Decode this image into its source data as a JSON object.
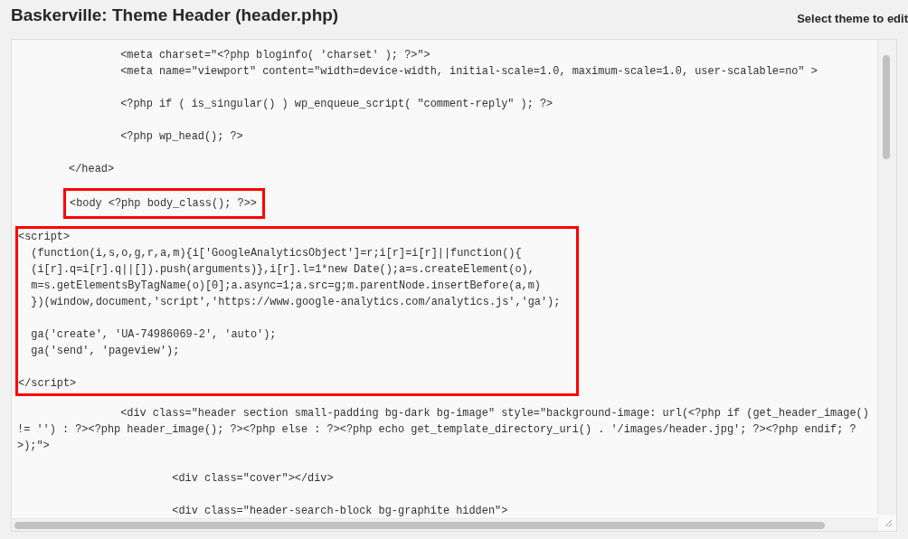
{
  "page_title": "Baskerville: Theme Header (header.php)",
  "theme_select_label": "Select theme to edit",
  "editor": {
    "blocks": [
      {
        "highlighted": false,
        "groups": [
          [
            "                <meta charset=\"<?php bloginfo( 'charset' ); ?>\">",
            "                <meta name=\"viewport\" content=\"width=device-width, initial-scale=1.0, maximum-scale=1.0, user-scalable=no\" >"
          ],
          [
            "                <?php if ( is_singular() ) wp_enqueue_script( \"comment-reply\" ); ?>"
          ],
          [
            "                <?php wp_head(); ?>"
          ],
          [
            "        </head>"
          ]
        ]
      },
      {
        "highlighted": true,
        "groups": [
          [
            "<body <?php body_class(); ?>>"
          ]
        ]
      },
      {
        "highlighted": true,
        "groups": [
          [
            "<script>",
            "  (function(i,s,o,g,r,a,m){i['GoogleAnalyticsObject']=r;i[r]=i[r]||function(){",
            "  (i[r].q=i[r].q||[]).push(arguments)},i[r].l=1*new Date();a=s.createElement(o),",
            "  m=s.getElementsByTagName(o)[0];a.async=1;a.src=g;m.parentNode.insertBefore(a,m)",
            "  })(window,document,'script','https://www.google-analytics.com/analytics.js','ga');"
          ],
          [
            "  ga('create', 'UA-74986069-2', 'auto');",
            "  ga('send', 'pageview');"
          ],
          [
            "</script>"
          ]
        ]
      },
      {
        "highlighted": false,
        "groups": [
          [
            "                <div class=\"header section small-padding bg-dark bg-image\" style=\"background-image: url(<?php if (get_header_image()",
            "!= '') : ?><?php header_image(); ?><?php else : ?><?php echo get_template_directory_uri() . '/images/header.jpg'; ?><?php endif; ?",
            ">);\">"
          ],
          [
            "                        <div class=\"cover\"></div>"
          ],
          [
            "                        <div class=\"header-search-block bg-graphite hidden\">"
          ]
        ]
      }
    ]
  }
}
